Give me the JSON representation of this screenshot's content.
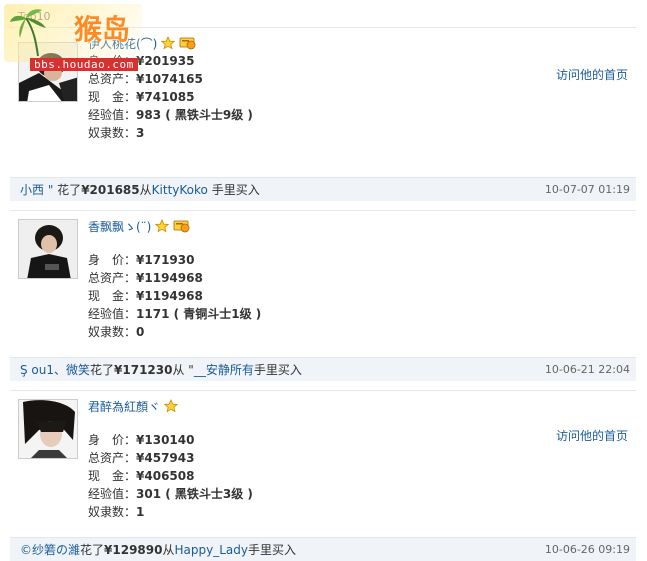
{
  "header": {
    "tab_label": "Top10"
  },
  "watermark": {
    "brand": "猴岛",
    "url": "bbs.houdao.com"
  },
  "labels": {
    "body_price": "身　价：",
    "total_assets": "总资产：",
    "cash": "现　金：",
    "experience": "经验值：",
    "slaves": "奴隶数：",
    "visit": "访问他的首页"
  },
  "entries": [
    {
      "name": "伊人桃花(⌒)",
      "body_price": "¥201935",
      "total_assets": "¥1074165",
      "cash": "¥741085",
      "experience": "983 ( 黑铁斗士9级 )",
      "slaves": "3",
      "has_medal": true
    },
    {
      "name": "香飘飘ゝ(¨)",
      "body_price": "¥171930",
      "total_assets": "¥1194968",
      "cash": "¥1194968",
      "experience": "1171 ( 青铜斗士1级 )",
      "slaves": "0",
      "has_medal": true
    },
    {
      "name": "君醉為紅顏ヾ",
      "body_price": "¥130140",
      "total_assets": "¥457943",
      "cash": "¥406508",
      "experience": "301 ( 黑铁斗士3级 )",
      "slaves": "1",
      "has_medal": false
    }
  ],
  "transactions": [
    {
      "buyer": "小西 \"",
      "spent": "花了",
      "amount": "¥201685",
      "from": "从",
      "seller": "KittyKoko",
      "action": "手里买入",
      "date": "10-07-07 01:19"
    },
    {
      "buyer": "Ş ou1、微笑",
      "spent": "花了",
      "amount": "¥171230",
      "from": "从 \"",
      "seller": "__安静所有",
      "action": "手里买入",
      "date": "10-06-21 22:04"
    },
    {
      "buyer": "©纱箬の濰",
      "spent": "花了",
      "amount": "¥129890",
      "from": "从",
      "seller": "Happy_Lady",
      "action": "手里买入",
      "date": "10-06-26 09:19"
    }
  ]
}
